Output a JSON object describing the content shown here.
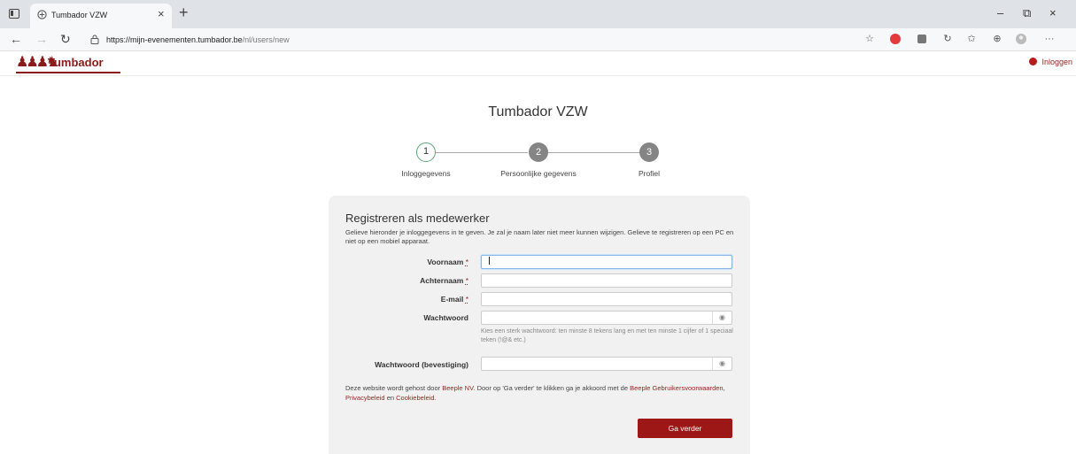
{
  "browser": {
    "tab_title": "Tumbador VZW",
    "tab_close": "×",
    "new_tab": "+",
    "url_host": "https://mijn-evenementen.tumbador.be",
    "url_path": "/nl/users/new",
    "window_controls": {
      "minimize": "–",
      "maximize": "⧉",
      "close": "×"
    },
    "nav": {
      "back": "←",
      "forward": "→",
      "refresh": "↻"
    },
    "ext_more": "···"
  },
  "site": {
    "logo_text": "Tumbador",
    "login_label": "Inloggen",
    "brand_color": "#9d1717"
  },
  "page": {
    "title": "Tumbador VZW",
    "steps": [
      {
        "number": "1",
        "label": "Inloggegevens",
        "state": "active"
      },
      {
        "number": "2",
        "label": "Persoonlijke gegevens",
        "state": "inactive"
      },
      {
        "number": "3",
        "label": "Profiel",
        "state": "inactive"
      }
    ],
    "form": {
      "heading": "Registreren als medewerker",
      "intro": "Gelieve hieronder je inloggegevens in te geven. Je zal je naam later niet meer kunnen wijzigen. Gelieve te registreren op een PC en niet op een mobiel apparaat.",
      "required_mark": "*",
      "fields": {
        "first_name": {
          "label": "Voornaam",
          "value": ""
        },
        "last_name": {
          "label": "Achternaam",
          "value": ""
        },
        "email": {
          "label": "E-mail",
          "value": ""
        },
        "password": {
          "label": "Wachtwoord",
          "value": ""
        },
        "password_confirm": {
          "label": "Wachtwoord (bevestiging)",
          "value": ""
        }
      },
      "password_hint": "Kies een sterk wachtwoord: ten minste 8 tekens lang en met ten minste 1 cijfer of 1 speciaal teken (!@& etc.)",
      "legal": {
        "part1": "Deze website wordt gehost door ",
        "link_beeple": "Beeple NV",
        "part2": ". Door op 'Ga verder' te klikken ga je akkoord met de ",
        "link_terms": "Beeple Gebruikersvoorwaarden",
        "sep1": ", ",
        "link_privacy": "Privacybeleid",
        "sep2": " en ",
        "link_cookie": "Cookiebeleid",
        "end": "."
      },
      "submit_label": "Ga verder"
    }
  }
}
